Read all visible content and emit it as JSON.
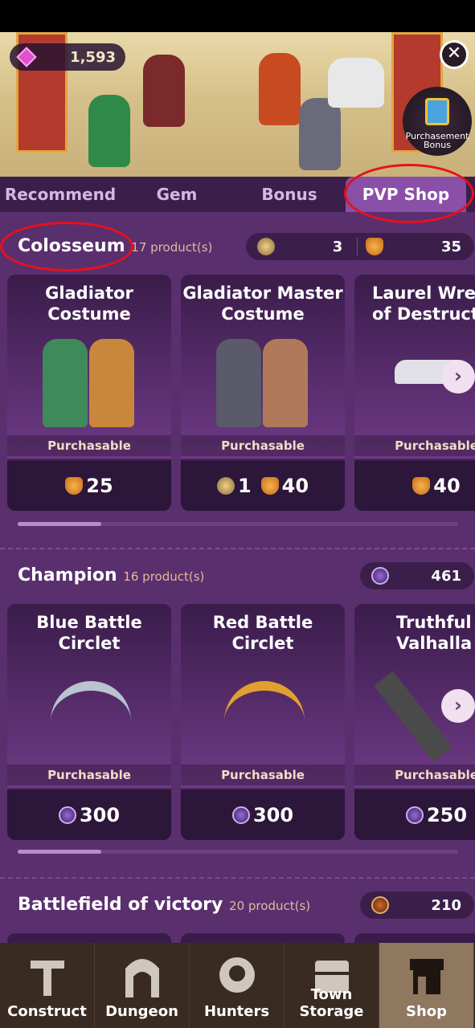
{
  "header": {
    "gems": "1,593",
    "close_glyph": "✕",
    "purchasement_bonus": "Purchasement Bonus"
  },
  "tabs": [
    {
      "label": "Recommend"
    },
    {
      "label": "Gem"
    },
    {
      "label": "Bonus"
    },
    {
      "label": "PVP Shop"
    }
  ],
  "sections": [
    {
      "title": "Colosseum",
      "count": "17 product(s)",
      "currencies": [
        {
          "icon": "wing-medal-icon",
          "value": "3"
        },
        {
          "icon": "shield-medal-icon",
          "value": "35"
        }
      ],
      "cards": [
        {
          "name": "Gladiator Costume",
          "status": "Purchasable",
          "price": "25",
          "price_icon": "shield-medal-icon"
        },
        {
          "name": "Gladiator Master Costume",
          "status": "Purchasable",
          "price1": "1",
          "price2": "40"
        },
        {
          "name": "Laurel Wreath of Destruction",
          "status": "Purchasable",
          "price": "40",
          "price_icon": "shield-medal-icon"
        }
      ],
      "scroll_position": 0.0
    },
    {
      "title": "Champion",
      "count": "16 product(s)",
      "currencies": [
        {
          "icon": "champion-medal-icon",
          "value": "461"
        }
      ],
      "cards": [
        {
          "name": "Blue Battle Circlet",
          "status": "Purchasable",
          "price": "300"
        },
        {
          "name": "Red Battle Circlet",
          "status": "Purchasable",
          "price": "300"
        },
        {
          "name": "Truthful Valhalla",
          "status": "Purchasable",
          "price": "250"
        }
      ],
      "scroll_position": 0.0
    },
    {
      "title": "Battlefield of victory",
      "count": "20 product(s)",
      "currencies": [
        {
          "icon": "victory-badge-icon",
          "value": "210"
        }
      ]
    }
  ],
  "nav": [
    {
      "label": "Construct",
      "icon": "hammer-icon"
    },
    {
      "label": "Dungeon",
      "icon": "gate-icon"
    },
    {
      "label": "Hunters",
      "icon": "crest-icon"
    },
    {
      "label": "Town Storage",
      "icon": "chest-icon"
    },
    {
      "label": "Shop",
      "icon": "shop-icon"
    }
  ],
  "colors": {
    "background": "#5a2f6e",
    "tab_active": "#8a4fa6",
    "annotation": "#e8101b",
    "nav_bar": "#3a2b22"
  }
}
